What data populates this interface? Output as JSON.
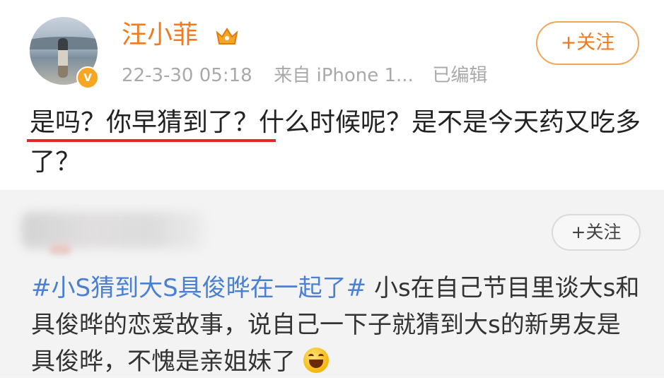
{
  "post": {
    "username": "汪小菲",
    "timestamp": "22-3-30 05:18",
    "source": "来自 iPhone 1...",
    "edited": "已编辑",
    "follow_label": "+关注",
    "text": "是吗？你早猜到了？什么时候呢？是不是今天药又吃多了？",
    "badges": {
      "verified_icon": "v-verified-icon",
      "vip_icon": "crown-icon"
    },
    "colors": {
      "username": "#f07a1e",
      "underline": "#e32727"
    }
  },
  "repost": {
    "follow_label": "+关注",
    "hashtag": "#小S猜到大S具俊晔在一起了#",
    "text": "小s在自己节目里谈大s和具俊晔的恋爱故事，说自己一下子就猜到大s的新男友是具俊晔，不愧是亲姐妹了",
    "emoji_icon": "laughing-emoji-icon",
    "colors": {
      "hashtag": "#4a7fd1",
      "background": "#f3f3f3"
    }
  }
}
